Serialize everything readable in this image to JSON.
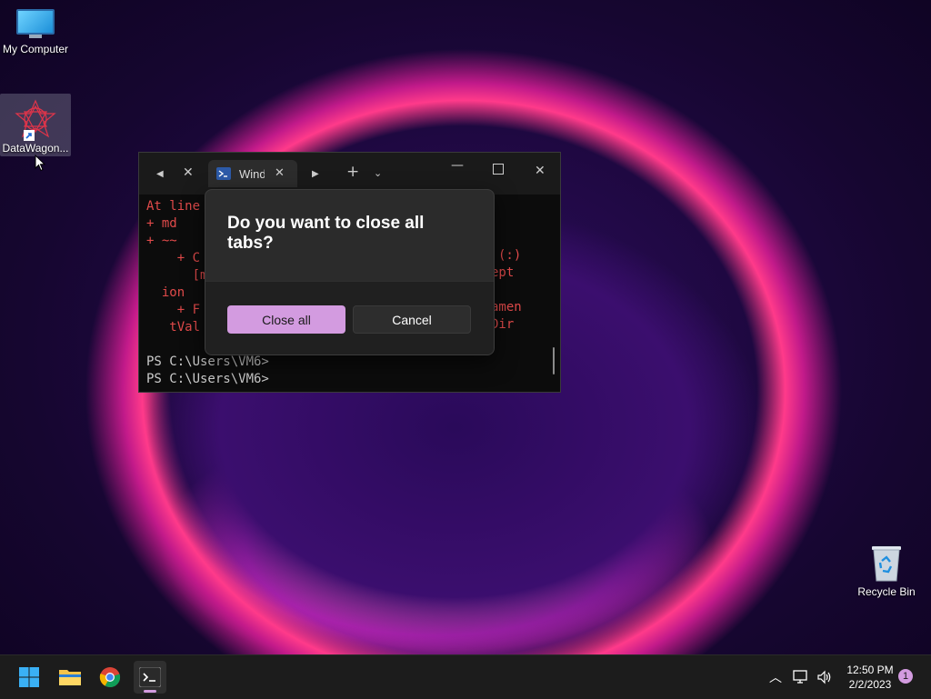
{
  "desktop": {
    "icons": [
      {
        "label": "My Computer"
      },
      {
        "label": "DataWagon..."
      },
      {
        "label": "Recycle Bin"
      }
    ]
  },
  "terminal": {
    "tab_title": "Wind",
    "error_lines": [
      "At line",
      "+ md",
      "+ ~~",
      "    + C",
      "      [mk",
      "  ion",
      "    + F",
      "   tVal"
    ],
    "error_fragments": [
      "(:)",
      "ept",
      "amen",
      "Dir"
    ],
    "prompt_lines": [
      "PS C:\\Users\\VM6>",
      "PS C:\\Users\\VM6>"
    ]
  },
  "dialog": {
    "title": "Do you want to close all tabs?",
    "primary_label": "Close all",
    "secondary_label": "Cancel"
  },
  "taskbar": {
    "time": "12:50 PM",
    "date": "2/2/2023",
    "notification_count": "1"
  },
  "colors": {
    "accent": "#d39be0",
    "error_text": "#e04a4a"
  }
}
